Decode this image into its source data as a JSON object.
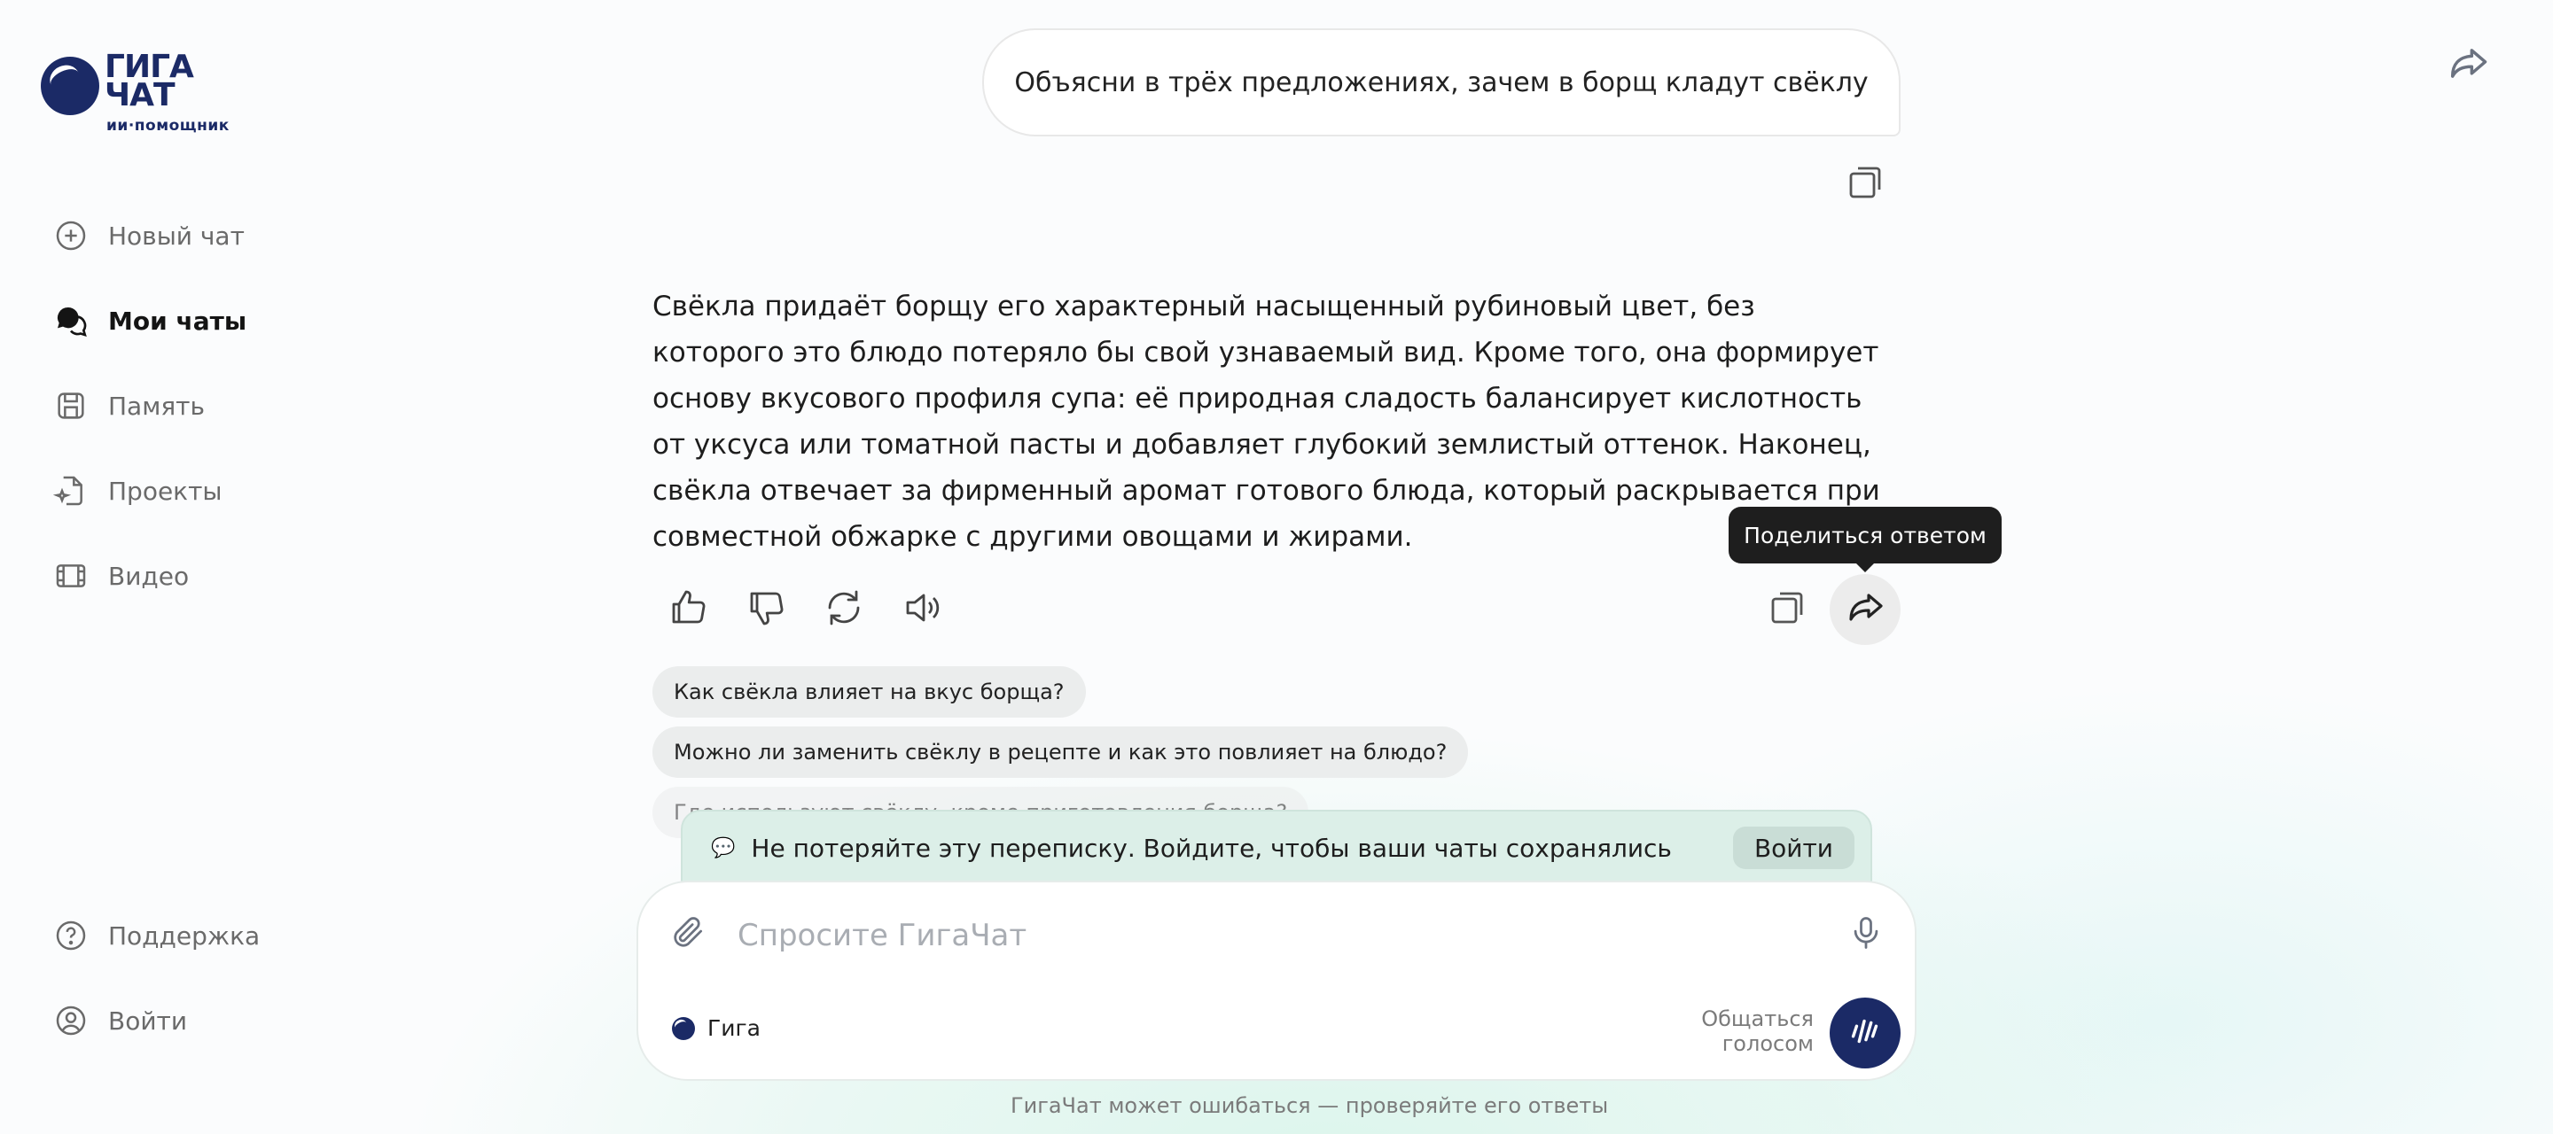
{
  "brand": {
    "logo_word": "ГИГА ЧАТ",
    "logo_subtitle": "ии·помощник"
  },
  "sidebar": {
    "items": [
      {
        "label": "Новый чат",
        "icon": "plus-circle-icon"
      },
      {
        "label": "Мои чаты",
        "icon": "chat-bubbles-icon"
      },
      {
        "label": "Память",
        "icon": "save-icon"
      },
      {
        "label": "Проекты",
        "icon": "sparkle-doc-icon"
      },
      {
        "label": "Видео",
        "icon": "film-icon"
      }
    ],
    "bottom_items": [
      {
        "label": "Поддержка",
        "icon": "help-circle-icon"
      },
      {
        "label": "Войти",
        "icon": "user-circle-icon"
      }
    ]
  },
  "chat": {
    "user_message": "Объясни в трёх предложениях, зачем в борщ кладут свёклу",
    "answer": "Свёкла придаёт борщу его характерный насыщенный рубиновый цвет, без которого это блюдо потеряло бы свой узнаваемый вид. Кроме того, она формирует основу вкусового профиля супа: её природная сладость балансирует кислотность от уксуса или томатной пасты и добавляет глубокий землистый оттенок. Наконец, свёкла отвечает за фирменный аромат готового блюда, который раскрывается при совместной обжарке с другими овощами и жирами.",
    "share_tooltip": "Поделиться ответом",
    "suggestions": [
      "Как свёкла влияет на вкус борща?",
      "Можно ли заменить свёклу в рецепте и как это повлияет на блюдо?",
      "Где используют свёклу, кроме приготовления борща?"
    ]
  },
  "banner": {
    "text": "Не потеряйте эту переписку. Войдите, чтобы ваши чаты сохранялись",
    "login_label": "Войти"
  },
  "composer": {
    "placeholder": "Спросите ГигаЧат",
    "model_label": "Гига",
    "voice_label_line1": "Общаться",
    "voice_label_line2": "голосом"
  },
  "footer": {
    "disclaimer": "ГигаЧат может ошибаться — проверяйте его ответы"
  },
  "colors": {
    "brand": "#1b2a66",
    "tooltip": "#1e1e1e",
    "banner": "#dcefe8"
  }
}
